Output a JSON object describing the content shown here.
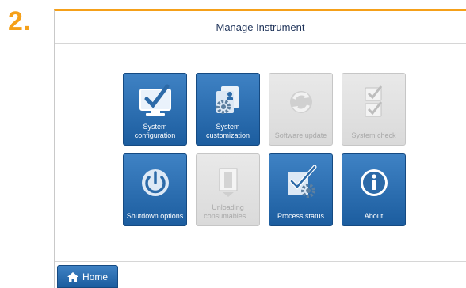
{
  "step_number": "2.",
  "window": {
    "title": "Manage Instrument"
  },
  "tiles": [
    {
      "label": "System configuration",
      "icon": "monitor-check-icon",
      "enabled": true
    },
    {
      "label": "System customization",
      "icon": "document-gear-icon",
      "enabled": true
    },
    {
      "label": "Software update",
      "icon": "refresh-icon",
      "enabled": false
    },
    {
      "label": "System check",
      "icon": "checklist-icon",
      "enabled": false
    },
    {
      "label": "Shutdown options",
      "icon": "power-icon",
      "enabled": true
    },
    {
      "label": "Unloading consumables...",
      "icon": "drawer-unload-icon",
      "enabled": false
    },
    {
      "label": "Process status",
      "icon": "clipboard-gear-icon",
      "enabled": true
    },
    {
      "label": "About",
      "icon": "info-icon",
      "enabled": true
    }
  ],
  "footer": {
    "home_label": "Home",
    "home_icon": "home-icon"
  },
  "colors": {
    "accent": "#f5a019",
    "tile_active": "#2a6db0",
    "tile_disabled": "#e2e2e2",
    "title_text": "#22365c"
  }
}
